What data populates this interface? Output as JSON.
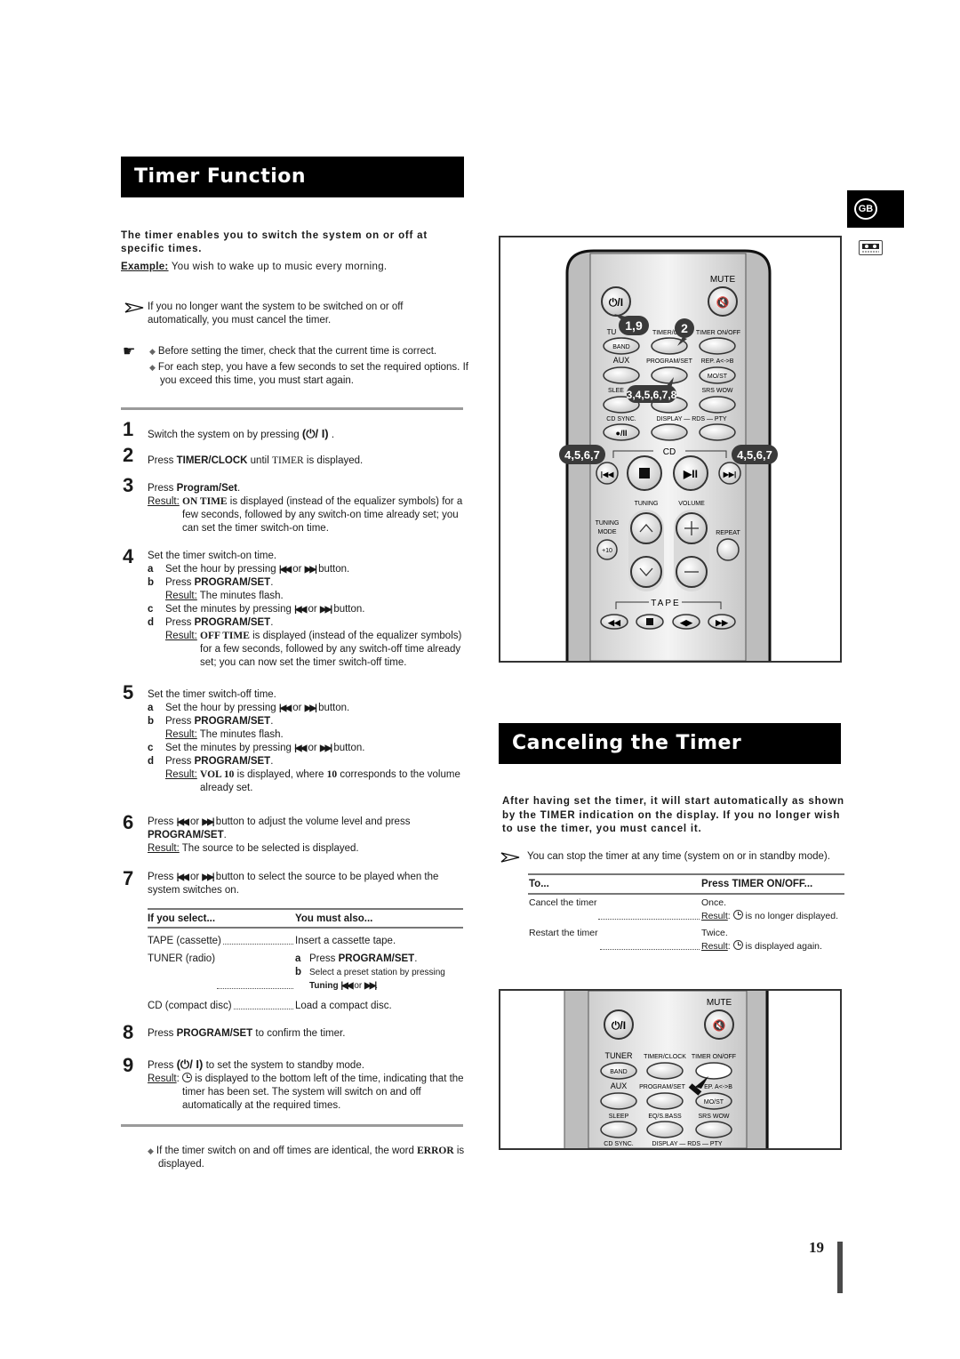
{
  "timer_function": {
    "title": "Timer Function",
    "lead": "The timer enables you to switch the system on or off at specific times.",
    "example_label": "Example:",
    "example_text": " You wish to wake up to music every morning.",
    "note_cancel": "If you no longer want the system to be switched on or off automatically, you must cancel the timer.",
    "tip_1": "Before setting the timer, check that the current time is correct.",
    "tip_2": "For each step, you have a few seconds to set the required options. If you exceed this time, you must start again.",
    "steps": [
      {
        "num": "1",
        "pre": "Switch the system on by pressing ",
        "symbol": "(⏻/ I)",
        "post": " ."
      },
      {
        "num": "2",
        "pre": "Press ",
        "bold": "TIMER/CLOCK",
        "mid": " until  ",
        "serif": "TIMER",
        "post": " is displayed."
      },
      {
        "num": "3",
        "pre": "Press ",
        "bold": "Program/Set",
        "post": ".",
        "result_label": "Result:",
        "result_serif": "ON TIME",
        "result_text": " is displayed (instead of the equalizer symbols) for a few seconds, followed by any switch-on time already set; you can set the timer switch-on time."
      },
      {
        "num": "4",
        "text": "Set the timer switch-on time.",
        "a": "Set the hour by pressing ",
        "a_post": " button.",
        "b_pre": "Press ",
        "b_bold": "PROGRAM/SET",
        "b_post": ".",
        "b_result_label": "Result:",
        "b_result": " The minutes flash.",
        "c": "Set the minutes by pressing ",
        "c_post": " button.",
        "d_pre": "Press ",
        "d_bold": "PROGRAM/SET",
        "d_post": ".",
        "d_result_label": "Result:",
        "d_result_serif": "OFF TIME",
        "d_result": " is displayed (instead of the equalizer symbols) for a few seconds, followed by any switch-off time already set; you can now set the timer switch-off time."
      },
      {
        "num": "5",
        "text": "Set the timer switch-off time.",
        "a": "Set the hour by pressing ",
        "a_post": " button.",
        "b_pre": "Press ",
        "b_bold": "PROGRAM/SET",
        "b_post": ".",
        "b_result_label": "Result:",
        "b_result": " The minutes flash.",
        "c": "Set the minutes by pressing ",
        "c_post": " button.",
        "d_pre": "Press ",
        "d_bold": "PROGRAM/SET",
        "d_post": ".",
        "d_result_label": "Result:",
        "d_result_serif": "VOL 10",
        "d_result_mid": " is displayed, where ",
        "d_result_serif2": "10",
        "d_result": " corresponds to the volume already set."
      },
      {
        "num": "6",
        "pre": "Press ",
        "mid": " button to adjust the volume level and press ",
        "bold": "PROGRAM/SET",
        "post": ".",
        "result_label": "Result:",
        "result_text": " The source to be selected is displayed."
      },
      {
        "num": "7",
        "pre": "Press ",
        "mid": " button to select the source to be played when the system switches on."
      },
      {
        "num": "8",
        "pre": "Press ",
        "bold": "PROGRAM/SET",
        "post": " to confirm the timer."
      },
      {
        "num": "9",
        "pre": "Press ",
        "symbol": "(⏻/ I)",
        "post": " to set the system to standby mode.",
        "result_label": "Result",
        "result_text": " is displayed to the bottom left of the time, indicating that the timer has been set. The system will switch on and off automatically at the required times."
      }
    ],
    "letters": [
      "a",
      "b",
      "c",
      "d"
    ],
    "or": "or",
    "prev_icon": "skip-back-icon",
    "next_icon": "skip-forward-icon",
    "source_table": {
      "headers": [
        "If you select...",
        "You must also..."
      ],
      "rows": [
        {
          "source": "TAPE (cassette)",
          "action": "Insert a cassette tape."
        },
        {
          "source": "TUNER (radio)",
          "action_a_pre": "Press ",
          "action_a_bold": "PROGRAM/SET",
          "action_a_post": ".",
          "action_b": "Select a preset station by pressing",
          "action_b2_bold": "Tuning",
          "action_b2_post": "."
        },
        {
          "source": "CD (compact disc)",
          "action": "Load a compact disc."
        }
      ]
    },
    "footnote_pre": "If the timer switch on and off times are identical, the word ",
    "footnote_serif": "ERROR",
    "footnote_post": " is displayed."
  },
  "remote": {
    "mute": "MUTE",
    "power": "⏻/I",
    "tuner": "TU",
    "tuner_full": "TUNER",
    "timer_clock": "TIMER/CLO",
    "timer_clock_full": "TIMER/CLOCK",
    "timer_onoff": "TIMER ON/OFF",
    "band": "BAND",
    "aux": "AUX",
    "program_set": "PROGRAM/SET",
    "rep_ab": "REP. A<->B",
    "rep_ab_partial": "EP. A<->B",
    "mo_st": "MO/ST",
    "sleep": "SLEE",
    "sleep_full": "SLEEP",
    "eq_bass_partial": "S",
    "eq_bass": "EQ/S.BASS",
    "srs_wow": "SRS WOW",
    "cd_sync": "CD SYNC.",
    "display_rds_pty": "DISPLAY — RDS — PTY",
    "rec_pause": "●/II",
    "cd": "CD",
    "tuning": "TUNING",
    "volume": "VOLUME",
    "tuning_mode_1": "TUNING",
    "tuning_mode_2": "MODE",
    "plus10": "+10",
    "repeat": "REPEAT",
    "tape": "TAPE",
    "callouts": {
      "power": "1,9",
      "timer_clock": "2",
      "program_set": "3,4,5,6,7,8",
      "prev": "4,5,6,7",
      "next": "4,5,6,7"
    }
  },
  "canceling": {
    "title": "Canceling the Timer",
    "lead": "After having set the timer, it will start automatically as shown by the TIMER indication on the display. If you no longer wish to use the timer, you must cancel it.",
    "note": "You can stop the timer at any time (system on or in standby mode).",
    "table": {
      "headers": [
        "To...",
        "Press TIMER ON/OFF..."
      ],
      "rows": [
        {
          "action": "Cancel the timer",
          "press": "Once.",
          "result_label": "Result",
          "result_text": " is no longer displayed."
        },
        {
          "action": "Restart the timer",
          "press": "Twice.",
          "result_label": "Result",
          "result_text": " is displayed again."
        }
      ]
    }
  },
  "side_tab": {
    "language": "GB",
    "section_icon": "cassette-icon"
  },
  "page_number": "19"
}
